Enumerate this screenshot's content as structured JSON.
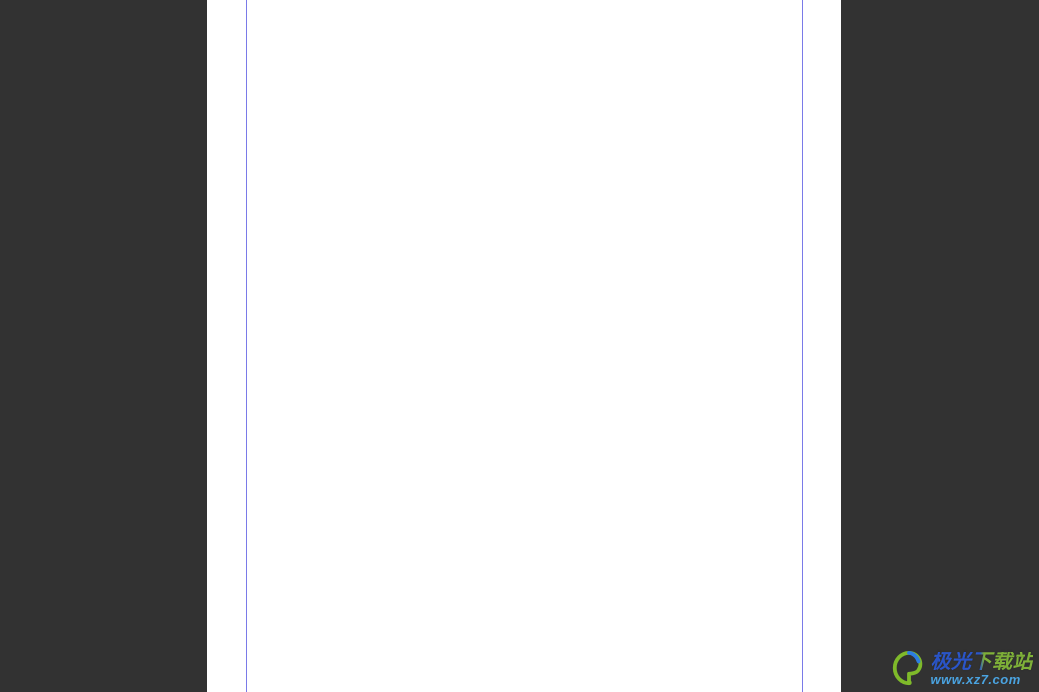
{
  "document": {
    "page_content": ""
  },
  "watermark": {
    "title": "极光下载站",
    "url": "www.xz7.com"
  }
}
